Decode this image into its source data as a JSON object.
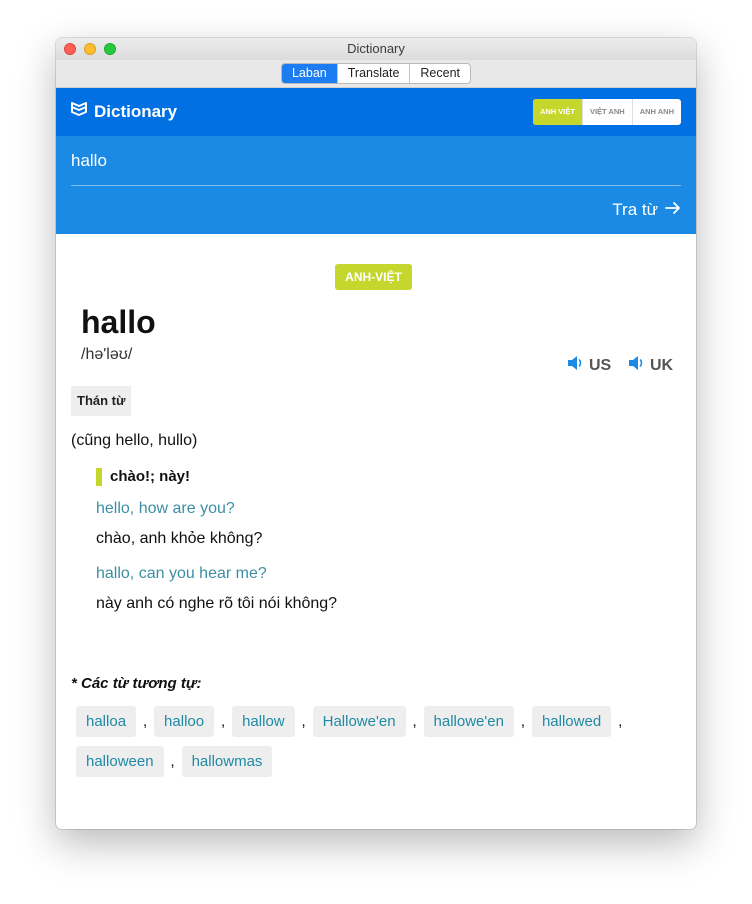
{
  "window": {
    "title": "Dictionary"
  },
  "tabs": [
    "Laban",
    "Translate",
    "Recent"
  ],
  "header": {
    "brand": "Dictionary",
    "lang_switch": [
      "ANH VIỆT",
      "VIỆT ANH",
      "ANH ANH"
    ]
  },
  "search": {
    "value": "hallo",
    "lookup_label": "Tra từ"
  },
  "entry": {
    "lang_badge": "ANH-VIỆT",
    "word": "hallo",
    "ipa": "/hə'ləʊ/",
    "pron_us": "US",
    "pron_uk": "UK",
    "part_of_speech": "Thán từ",
    "note": "(cũng hello, hullo)",
    "meaning": "chào!; này!",
    "examples": [
      {
        "en": "hello, how are you?",
        "vi": "chào, anh khỏe không?"
      },
      {
        "en": "hallo, can you hear me?",
        "vi": "này anh có nghe rõ tôi nói không?"
      }
    ]
  },
  "similar": {
    "title": "* Các từ tương tự:",
    "words": [
      "halloa",
      "halloo",
      "hallow",
      "Hallowe'en",
      "hallowe'en",
      "hallowed",
      "halloween",
      "hallowmas"
    ]
  },
  "colors": {
    "header_blue": "#0070e2",
    "search_blue": "#1a8ae4",
    "accent_green": "#c5d62c",
    "example_teal": "#3c8fa3"
  }
}
